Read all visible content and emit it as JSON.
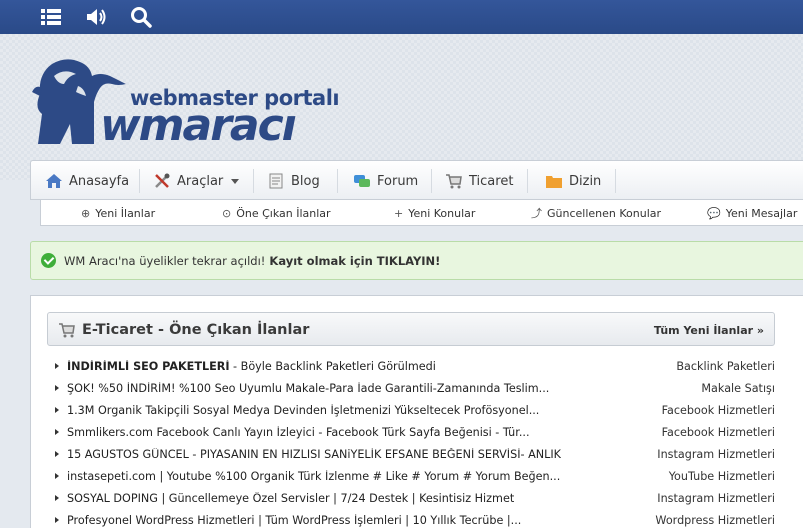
{
  "topbar": {
    "icons": [
      "menu-icon",
      "speaker-icon",
      "search-icon"
    ]
  },
  "logo": {
    "tagline": "webmaster portalı",
    "word": "wmaracı"
  },
  "nav": {
    "items": [
      {
        "label": "Anasayfa",
        "icon": "home-icon"
      },
      {
        "label": "Araçlar",
        "icon": "tools-icon"
      },
      {
        "label": "Blog",
        "icon": "blog-icon"
      },
      {
        "label": "Forum",
        "icon": "forum-icon"
      },
      {
        "label": "Ticaret",
        "icon": "cart-icon"
      },
      {
        "label": "Dizin",
        "icon": "folder-icon"
      }
    ]
  },
  "subnav": {
    "items": [
      {
        "label": "Yeni İlanlar",
        "icon": "⊕"
      },
      {
        "label": "Öne Çıkan İlanlar",
        "icon": "⊙"
      },
      {
        "label": "Yeni Konular",
        "icon": "+"
      },
      {
        "label": "Güncellenen Konular",
        "icon": "⤴"
      },
      {
        "label": "Yeni Mesajlar",
        "icon": "💬"
      }
    ]
  },
  "alert": {
    "text": "WM Aracı'na üyelikler tekrar açıldı!",
    "link": "Kayıt olmak için TIKLAYIN!"
  },
  "panel": {
    "title": "E-Ticaret - Öne Çıkan İlanlar",
    "all_link": "Tüm Yeni İlanlar »",
    "rows": [
      {
        "bold": "İNDİRİMLİ SEO PAKETLERİ",
        "title": " - Böyle Backlink Paketleri Görülmedi",
        "cat": "Backlink Paketleri"
      },
      {
        "bold": "",
        "title": "ŞOK! %50 İNDİRİM! %100 Seo Uyumlu Makale-Para İade Garantili-Zamanında Teslim...",
        "cat": "Makale Satışı"
      },
      {
        "bold": "",
        "title": "1.3M Organik Takipçili Sosyal Medya Devinden İşletmenizi Yükseltecek Profösyonel...",
        "cat": "Facebook Hizmetleri"
      },
      {
        "bold": "",
        "title": "Smmlikers.com Facebook Canlı Yayın İzleyici - Facebook Türk Sayfa Beğenisi - Tür...",
        "cat": "Facebook Hizmetleri"
      },
      {
        "bold": "",
        "title": "15 AGUSTOS GÜNCEL - PIYASANIN EN HIZLISI SANiYELİK EFSANE BEĞENİ SERVİSİ- ANLIK",
        "cat": "Instagram Hizmetleri"
      },
      {
        "bold": "",
        "title": "instasepeti.com | Youtube %100 Organik Türk İzlenme # Like # Yorum # Yorum Beğen...",
        "cat": "YouTube Hizmetleri"
      },
      {
        "bold": "",
        "title": "SOSYAL DOPING | Güncellemeye Özel Servisler | 7/24 Destek | Kesintisiz Hizmet",
        "cat": "Instagram Hizmetleri"
      },
      {
        "bold": "",
        "title": "Profesyonel WordPress Hizmetleri | Tüm WordPress İşlemleri | 10 Yıllık Tecrübe |...",
        "cat": "Wordpress Hizmetleri"
      }
    ]
  }
}
